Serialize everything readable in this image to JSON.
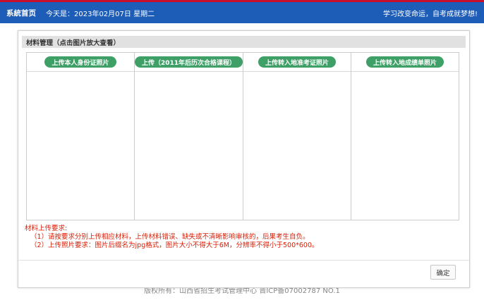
{
  "header": {
    "home_label": "系統首页",
    "date_text": "今天是：2023年02月07日   星期二",
    "slogan": "学习改变命运，自考成就梦想!"
  },
  "footer": {
    "text": "版权所有：山西省招生考试管理中心  晋ICP备07002787  NO.1"
  },
  "dialog": {
    "section_title": "材料管理（点击图片放大查看）",
    "upload_buttons": [
      "上传本人身份证照片",
      "上传（2011年后历次合格课程）",
      "上传转入地准考证照片",
      "上传转入地成绩单照片"
    ],
    "requirements": {
      "title": "材料上传要求:",
      "items": [
        "（1）请按要求分别上传相应材料，上传材料错误、缺失或不清晰影响审核的，后果考生自负。",
        "（2）上传照片要求：图片后缀名为jpg格式，图片大小不得大于6M，分辨率不得小于500*600。"
      ]
    },
    "confirm_label": "确定"
  },
  "colors": {
    "header_bg": "#1d5db8",
    "upload_button": "#3ea066",
    "requirement_text": "#d81e06"
  }
}
